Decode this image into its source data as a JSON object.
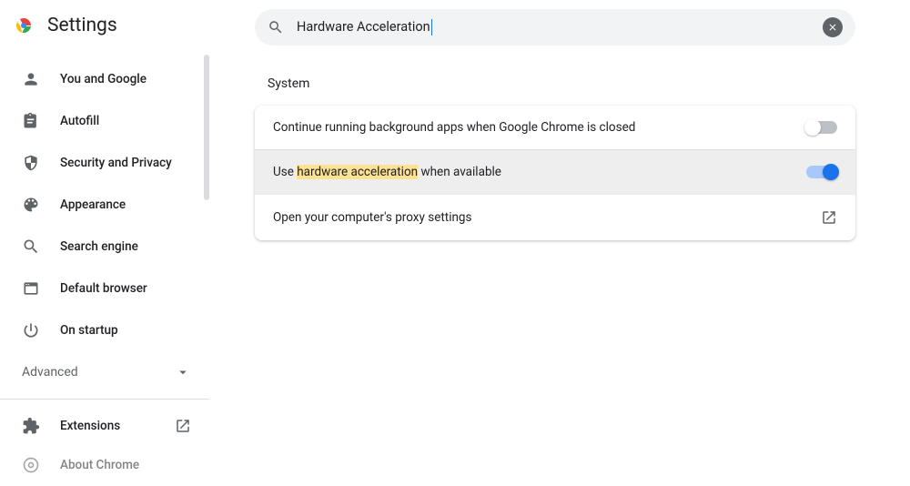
{
  "header": {
    "title": "Settings"
  },
  "search": {
    "value": "Hardware Acceleration"
  },
  "sidebar": {
    "items": [
      {
        "label": "You and Google",
        "icon": "person"
      },
      {
        "label": "Autofill",
        "icon": "assignment"
      },
      {
        "label": "Security and Privacy",
        "icon": "shield"
      },
      {
        "label": "Appearance",
        "icon": "palette"
      },
      {
        "label": "Search engine",
        "icon": "search"
      },
      {
        "label": "Default browser",
        "icon": "browser"
      },
      {
        "label": "On startup",
        "icon": "power"
      }
    ],
    "advanced_label": "Advanced",
    "extensions_label": "Extensions",
    "about_label": "About Chrome"
  },
  "section": {
    "title": "System",
    "rows": [
      {
        "label": "Continue running background apps when Google Chrome is closed",
        "type": "toggle",
        "on": false
      },
      {
        "label_pre": "Use ",
        "label_mark": "hardware acceleration",
        "label_post": " when available",
        "type": "toggle",
        "on": true,
        "highlighted": true
      },
      {
        "label": "Open your computer's proxy settings",
        "type": "link"
      }
    ]
  }
}
